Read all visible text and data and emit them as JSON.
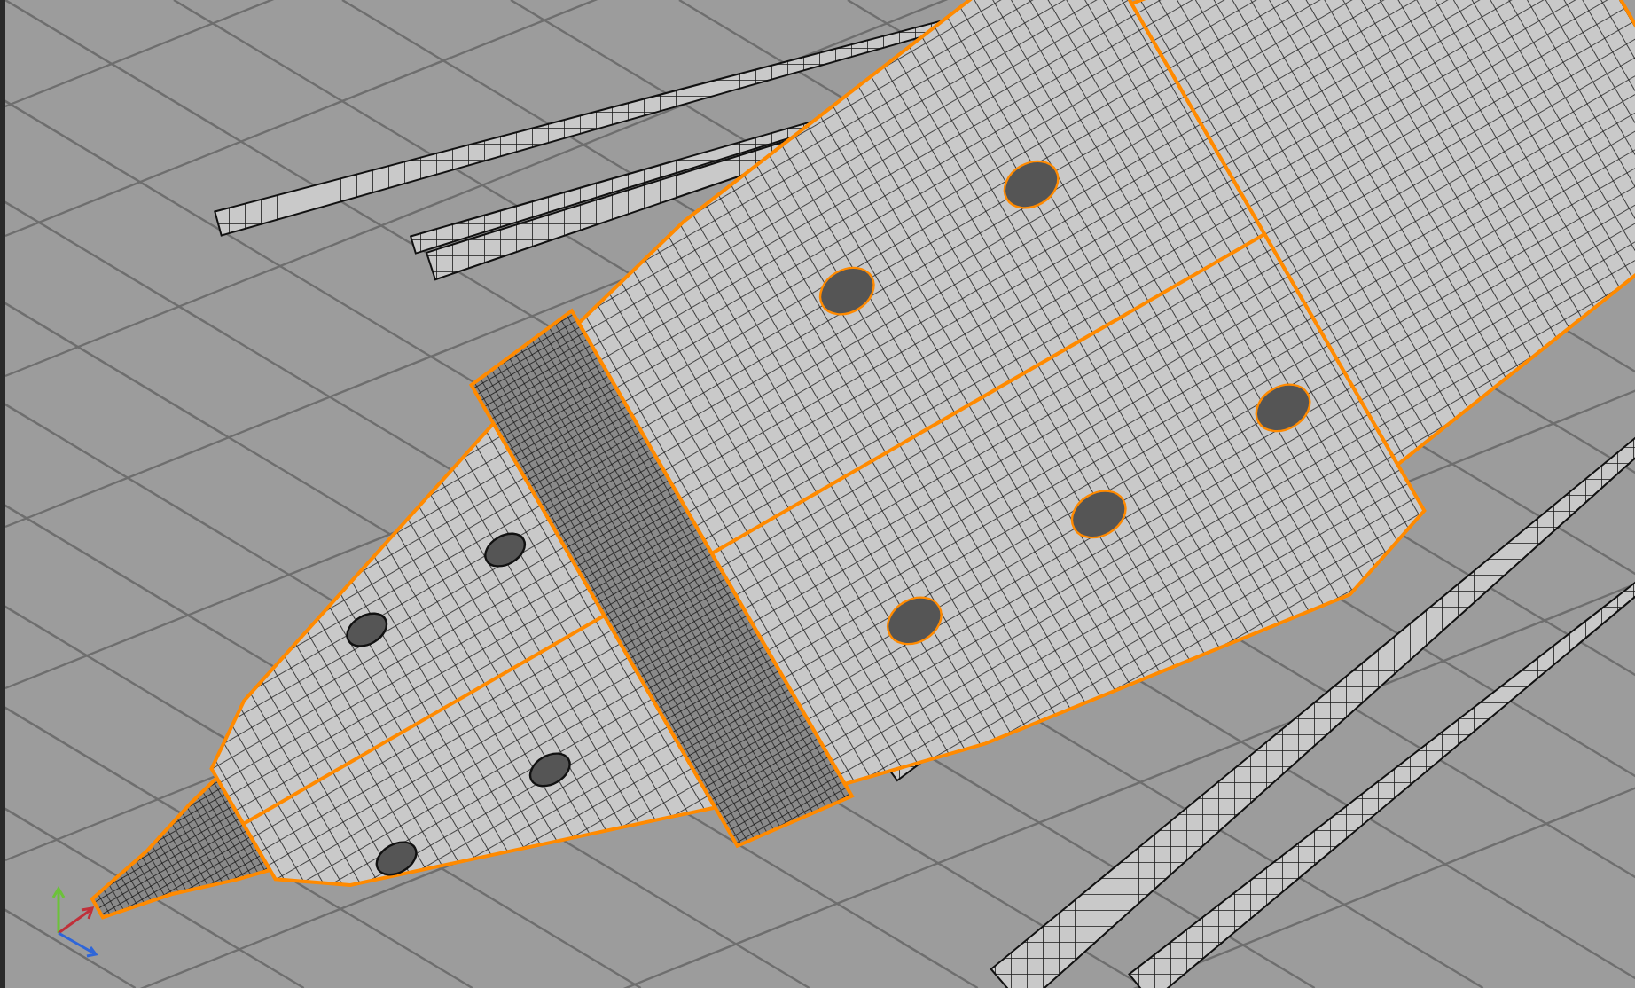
{
  "viewport": {
    "grid": true,
    "axis_gizmo": true
  }
}
